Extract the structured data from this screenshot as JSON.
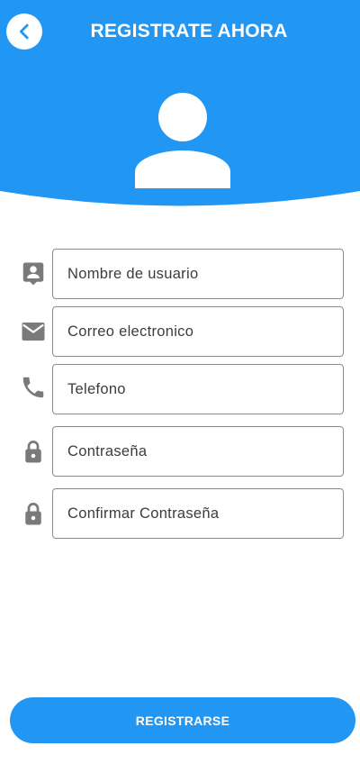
{
  "header": {
    "title": "REGISTRATE AHORA",
    "back_icon": "chevron-left-icon",
    "avatar_icon": "person-icon",
    "color": "#2196f3"
  },
  "form": {
    "fields": [
      {
        "icon": "account-box-icon",
        "placeholder": "Nombre de usuario",
        "value": ""
      },
      {
        "icon": "mail-icon",
        "placeholder": "Correo electronico",
        "value": ""
      },
      {
        "icon": "phone-icon",
        "placeholder": "Telefono",
        "value": ""
      },
      {
        "icon": "lock-icon",
        "placeholder": "Contraseña",
        "value": ""
      },
      {
        "icon": "lock-icon",
        "placeholder": "Confirmar Contraseña",
        "value": ""
      }
    ]
  },
  "submit": {
    "label": "REGISTRARSE"
  },
  "colors": {
    "accent": "#2196f3",
    "icon": "#7a7a7a",
    "border": "#8a8a8a"
  }
}
